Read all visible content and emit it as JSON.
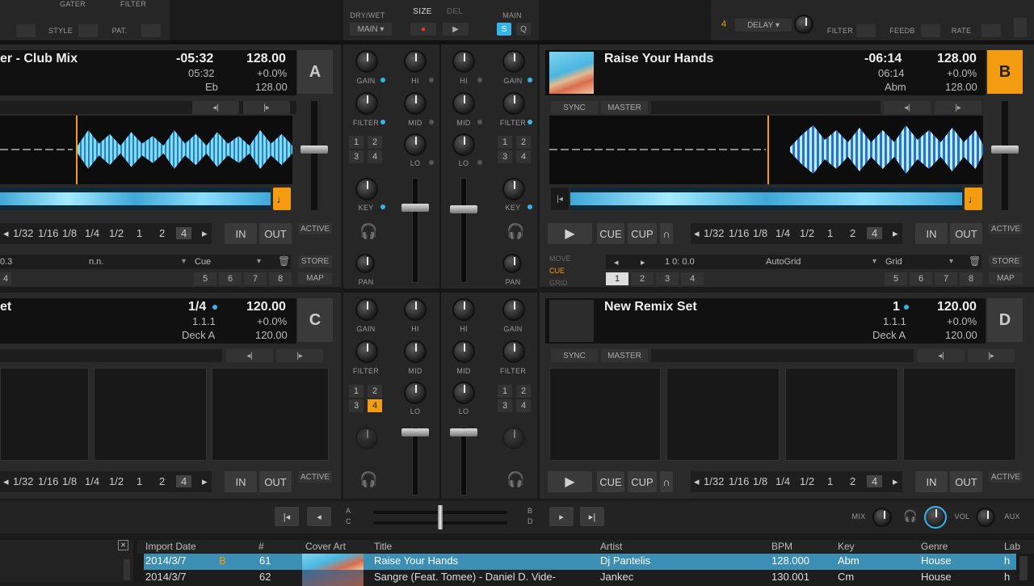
{
  "top_fx": {
    "left": {
      "labels": [
        "STYLE",
        "PAT.",
        "GATER",
        "FILTER"
      ]
    },
    "center": {
      "dry_wet": "DRY/WET",
      "size": "SIZE",
      "del": "DEL",
      "main": "MAIN",
      "main2": "MAIN",
      "s": "S",
      "q": "Q"
    },
    "right": {
      "four": "4",
      "delay": "DELAY",
      "labels": [
        "FILTER",
        "FEEDB",
        "RATE"
      ]
    }
  },
  "deck_a": {
    "title": "er - Club Mix",
    "remaining": "-05:32",
    "bpm": "128.00",
    "elapsed": "05:32",
    "pitch": "+0.0%",
    "key": "Eb",
    "bpm2": "128.00",
    "letter": "A",
    "loop_sizes": [
      "1/32",
      "1/16",
      "1/8",
      "1/4",
      "1/2",
      "1",
      "2",
      "4"
    ],
    "in": "IN",
    "out": "OUT",
    "active": "ACTIVE",
    "cue_value": "0.3",
    "cue_name": "n.n.",
    "cue_type": "Cue",
    "store": "STORE",
    "map": "MAP",
    "hotcues": [
      "4",
      "5",
      "6",
      "7",
      "8"
    ]
  },
  "deck_b": {
    "title": "Raise Your Hands",
    "remaining": "-06:14",
    "bpm": "128.00",
    "elapsed": "06:14",
    "pitch": "+0.0%",
    "key": "Abm",
    "bpm2": "128.00",
    "letter": "B",
    "sync": "SYNC",
    "master": "MASTER",
    "play": "▶",
    "cue": "CUE",
    "cup": "CUP",
    "loop_sizes": [
      "1/32",
      "1/16",
      "1/8",
      "1/4",
      "1/2",
      "1",
      "2",
      "4"
    ],
    "in": "IN",
    "out": "OUT",
    "active": "ACTIVE",
    "tabs": [
      "MOVE",
      "CUE",
      "GRID"
    ],
    "position": "1 0: 0.0",
    "autogrid": "AutoGrid",
    "grid": "Grid",
    "store": "STORE",
    "map": "MAP",
    "hotcues": [
      "1",
      "2",
      "3",
      "4",
      "5",
      "6",
      "7",
      "8"
    ]
  },
  "deck_c": {
    "title": "et",
    "pos": "1/4",
    "bpm": "120.00",
    "beat": "1.1.1",
    "pitch": "+0.0%",
    "source": "Deck A",
    "bpm2": "120.00",
    "letter": "C",
    "loop_sizes": [
      "1/32",
      "1/16",
      "1/8",
      "1/4",
      "1/2",
      "1",
      "2",
      "4"
    ],
    "in": "IN",
    "out": "OUT",
    "active": "ACTIVE"
  },
  "deck_d": {
    "title": "New Remix Set",
    "pos": "1",
    "bpm": "120.00",
    "beat": "1.1.1",
    "pitch": "+0.0%",
    "source": "Deck A",
    "bpm2": "120.00",
    "letter": "D",
    "sync": "SYNC",
    "master": "MASTER",
    "play": "▶",
    "cue": "CUE",
    "cup": "CUP",
    "loop_sizes": [
      "1/32",
      "1/16",
      "1/8",
      "1/4",
      "1/2",
      "1",
      "2",
      "4"
    ],
    "in": "IN",
    "out": "OUT",
    "active": "ACTIVE"
  },
  "mixer": {
    "gain": "GAIN",
    "hi": "HI",
    "mid": "MID",
    "lo": "LO",
    "filter": "FILTER",
    "key": "KEY",
    "pan": "PAN",
    "fx_assign": [
      "1",
      "2",
      "3",
      "4"
    ]
  },
  "master_bar": {
    "a": "A",
    "b": "B",
    "c": "C",
    "d": "D",
    "mix": "MIX",
    "vol": "VOL",
    "aux": "AUX"
  },
  "browser": {
    "columns": [
      "Import Date",
      "#",
      "Cover Art",
      "Title",
      "Artist",
      "BPM",
      "Key",
      "Genre",
      "Lab"
    ],
    "rows": [
      {
        "date": "2014/3/7",
        "flag": "B",
        "num": "61",
        "title": "Raise Your Hands",
        "artist": "Dj Pantelis",
        "bpm": "128.000",
        "key": "Abm",
        "genre": "House",
        "label": "h"
      },
      {
        "date": "2014/3/7",
        "flag": "",
        "num": "62",
        "title": "Sangre (Feat. Tomee) - Daniel D. Vide-",
        "artist": "Jankec",
        "bpm": "130.001",
        "key": "Cm",
        "genre": "House",
        "label": "h"
      }
    ]
  },
  "colors": {
    "accent_blue": "#37b3e6",
    "accent_orange": "#f39c12",
    "selected_row": "#3b8fb5"
  }
}
